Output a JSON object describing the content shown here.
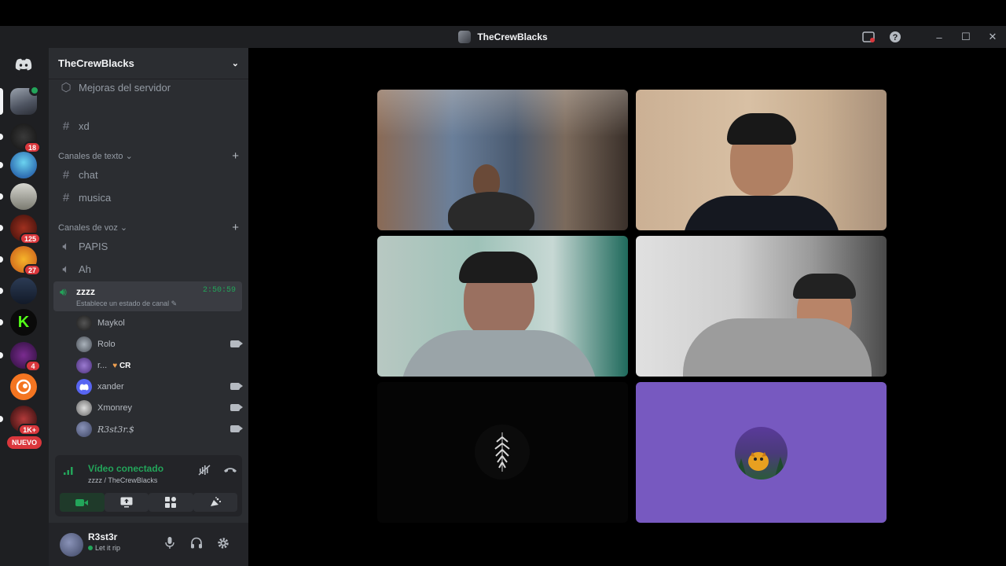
{
  "window": {
    "title": "TheCrewBlacks"
  },
  "server": {
    "name": "TheCrewBlacks"
  },
  "guild_badges": [
    "18",
    "125",
    "27",
    "4",
    "1K+"
  ],
  "guild_new_label": "NUEVO",
  "channels": {
    "boost": "Mejoras del servidor",
    "top_text": "xd",
    "text_category": "Canales de texto",
    "text_channels": [
      "chat",
      "musica"
    ],
    "voice_category": "Canales de voz",
    "voice_channels": [
      "PAPIS",
      "Ah"
    ],
    "active_voice": {
      "name": "zzzz",
      "timer": "2:50:59",
      "status": "Establece un estado de canal"
    },
    "members": [
      {
        "name": "Maykol",
        "camera": false
      },
      {
        "name": "Rolo",
        "camera": true
      },
      {
        "name": "r...",
        "tag": "CR",
        "camera": false
      },
      {
        "name": "xander",
        "camera": true
      },
      {
        "name": "Xmonrey",
        "camera": true
      },
      {
        "name": "R3st3r.$",
        "camera": true
      }
    ]
  },
  "voice_panel": {
    "title": "Vídeo conectado",
    "subtitle": "zzzz / TheCrewBlacks"
  },
  "user": {
    "name": "R3st3r",
    "status": "Let it rip"
  },
  "colors": {
    "accent_green": "#23a55a",
    "blurple": "#5865f2",
    "tile_purple": "#7759c0"
  },
  "icons": [
    "discord-logo-icon",
    "chevron-down-icon",
    "hash-icon",
    "speaker-icon",
    "plus-icon",
    "camera-icon",
    "screen-share-icon",
    "activities-icon",
    "soundboard-icon",
    "signal-icon",
    "noise-suppression-icon",
    "disconnect-icon",
    "microphone-icon",
    "headphones-icon",
    "settings-icon",
    "help-icon",
    "inbox-icon"
  ]
}
